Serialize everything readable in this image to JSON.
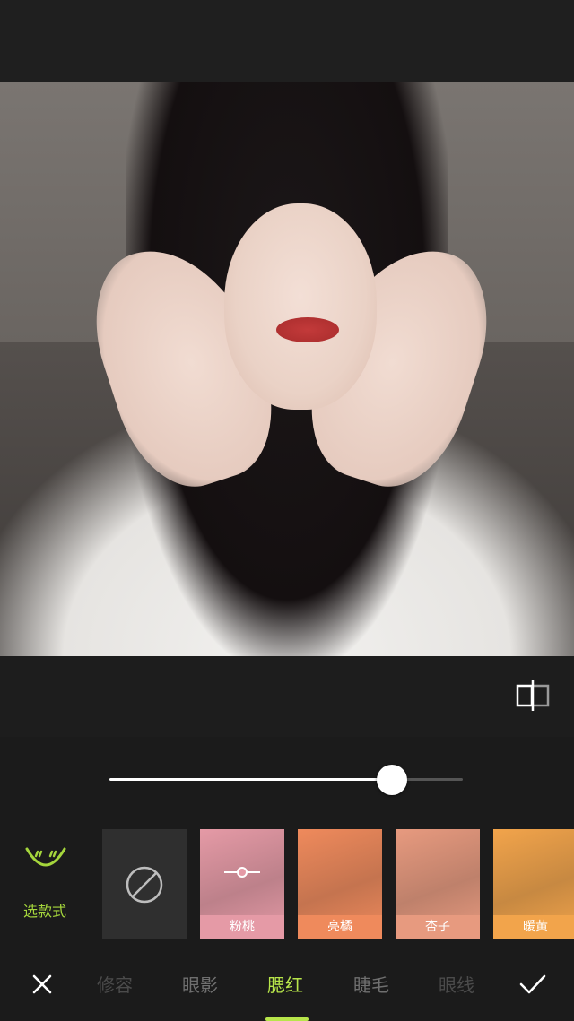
{
  "slider": {
    "value_fraction": 0.8
  },
  "style_picker": {
    "label": "选款式",
    "icon": "smile-face-icon",
    "accent": "#a5d63c"
  },
  "swatches": [
    {
      "type": "none",
      "icon": "none-icon"
    },
    {
      "label": "粉桃",
      "color": "#e59aa6",
      "selected": true
    },
    {
      "label": "亮橘",
      "color": "#ef8a5c"
    },
    {
      "label": "杏子",
      "color": "#e79a7f"
    },
    {
      "label": "暖黄",
      "color": "#f2a44b"
    }
  ],
  "tabs": [
    {
      "label": "修容",
      "state": "dim"
    },
    {
      "label": "眼影",
      "state": "normal"
    },
    {
      "label": "腮红",
      "state": "active"
    },
    {
      "label": "睫毛",
      "state": "normal"
    },
    {
      "label": "眼线",
      "state": "dim"
    }
  ],
  "icons": {
    "compare": "compare-icon",
    "close": "close-icon",
    "confirm": "check-icon"
  },
  "accent_color": "#b7e54a"
}
